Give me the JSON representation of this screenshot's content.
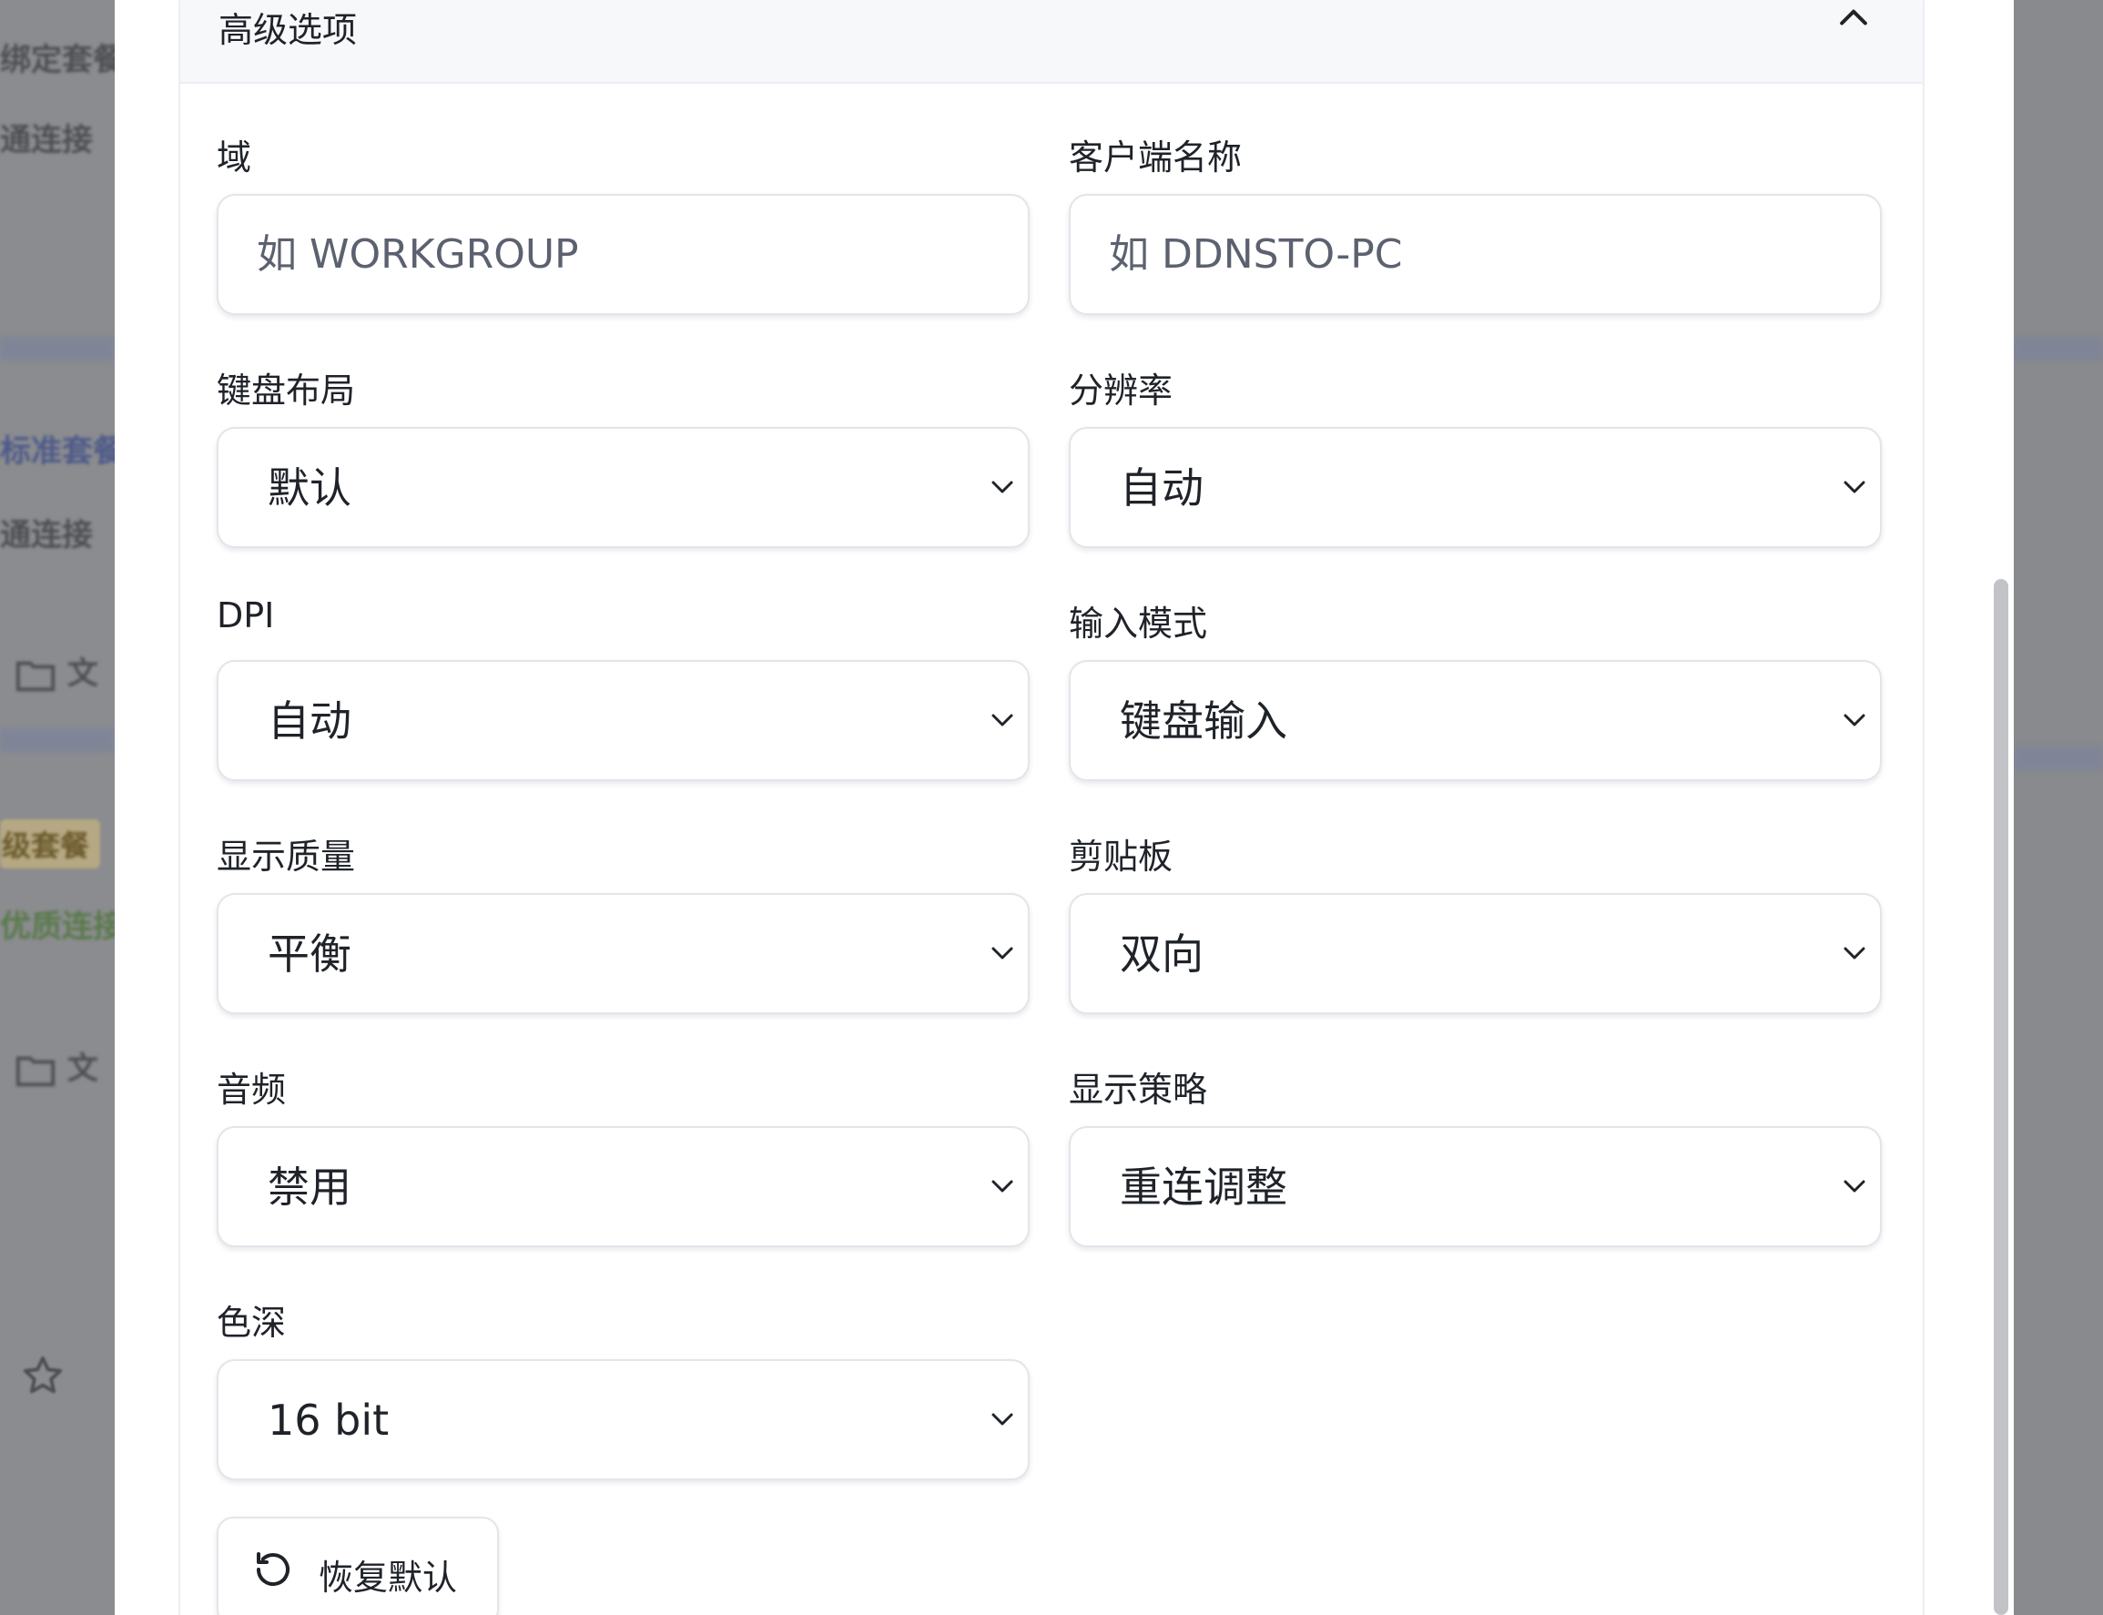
{
  "background": {
    "rows": [
      "绑定套餐",
      "通连接",
      "标准套餐",
      "通连接",
      "文",
      "级套餐",
      "优质连接",
      "文"
    ]
  },
  "panel": {
    "title": "高级选项"
  },
  "fields": {
    "domain": {
      "label": "域",
      "value": "",
      "placeholder": "如 WORKGROUP"
    },
    "client_name": {
      "label": "客户端名称",
      "value": "",
      "placeholder": "如 DDNSTO-PC"
    },
    "keyboard_layout": {
      "label": "键盘布局",
      "value": "默认"
    },
    "resolution": {
      "label": "分辨率",
      "value": "自动"
    },
    "dpi": {
      "label": "DPI",
      "value": "自动"
    },
    "input_mode": {
      "label": "输入模式",
      "value": "键盘输入"
    },
    "display_quality": {
      "label": "显示质量",
      "value": "平衡"
    },
    "clipboard": {
      "label": "剪贴板",
      "value": "双向"
    },
    "audio": {
      "label": "音频",
      "value": "禁用"
    },
    "display_strategy": {
      "label": "显示策略",
      "value": "重连调整"
    },
    "color_depth": {
      "label": "色深",
      "value": "16 bit"
    }
  },
  "actions": {
    "reset_label": "恢复默认"
  },
  "icons": {
    "collapse": "chevron-up-icon",
    "select": "chevron-down-icon",
    "reset": "rotate-ccw-icon",
    "folder": "folder-icon",
    "star": "star-icon"
  }
}
